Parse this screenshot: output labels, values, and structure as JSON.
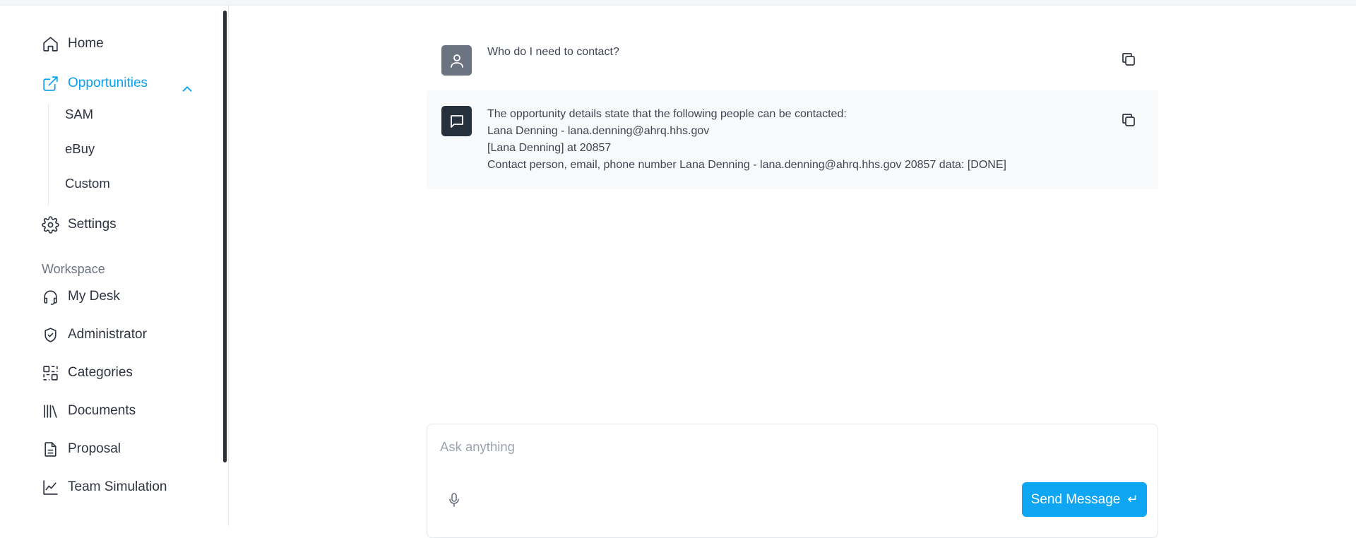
{
  "sidebar": {
    "home_label": "Home",
    "opportunities_label": "Opportunities",
    "sub_items": [
      "SAM",
      "eBuy",
      "Custom"
    ],
    "settings_label": "Settings",
    "workspace_heading": "Workspace",
    "workspace_items": [
      "My Desk",
      "Administrator",
      "Categories",
      "Documents",
      "Proposal",
      "Team Simulation"
    ],
    "accent_color": "#0aa0f0"
  },
  "chat": {
    "user_message": "Who do I need to contact?",
    "assistant_message": "The opportunity details state that the following people can be contacted:\nLana Denning - lana.denning@ahrq.hhs.gov\n[Lana Denning] at 20857\nContact person, email, phone number Lana Denning - lana.denning@ahrq.hhs.gov 20857 data: [DONE]"
  },
  "composer": {
    "placeholder": "Ask anything",
    "send_label": "Send Message",
    "send_icon": "↵"
  }
}
